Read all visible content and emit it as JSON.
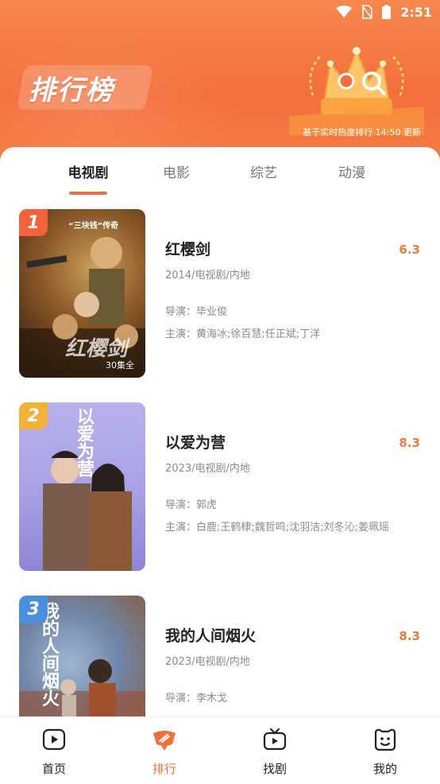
{
  "status_bar": {
    "time": "2:51"
  },
  "header": {
    "title": "排行榜",
    "update_note": "基于实时热度排行 14:50 更新"
  },
  "tabs": [
    {
      "label": "电视剧",
      "active": true
    },
    {
      "label": "电影",
      "active": false
    },
    {
      "label": "综艺",
      "active": false
    },
    {
      "label": "动漫",
      "active": false
    }
  ],
  "items": [
    {
      "rank": "1",
      "title": "红樱剑",
      "score": "6.3",
      "meta": "2014/电视剧/内地",
      "director": "导演：毕业俊",
      "cast": "主演：黄海冰;徐百慧;任正斌;丁洋",
      "poster_title": "红樱剑",
      "poster_tagline": "“三块钱”传奇",
      "poster_episodes": "30集全"
    },
    {
      "rank": "2",
      "title": "以爱为营",
      "score": "8.3",
      "meta": "2023/电视剧/内地",
      "director": "导演：郭虎",
      "cast": "主演：白鹿;王鹤棣;魏哲鸣;沈羽洁;刘冬沁;姜珮瑶",
      "poster_title": "以爱为营"
    },
    {
      "rank": "3",
      "title": "我的人间烟火",
      "score": "8.3",
      "meta": "2023/电视剧/内地",
      "director": "导演：李木戈",
      "cast": "",
      "poster_title": "我的人间烟火"
    }
  ],
  "bottom_nav": [
    {
      "label": "首页",
      "icon": "play-icon",
      "active": false
    },
    {
      "label": "排行",
      "icon": "ranking-icon",
      "active": true
    },
    {
      "label": "找剧",
      "icon": "tv-icon",
      "active": false
    },
    {
      "label": "我的",
      "icon": "face-icon",
      "active": false
    }
  ],
  "colors": {
    "accent": "#f26e3a",
    "score": "#f07a3b",
    "rank1": "#f2623a",
    "rank2": "#f2b23a",
    "rank3": "#4a90e2"
  }
}
